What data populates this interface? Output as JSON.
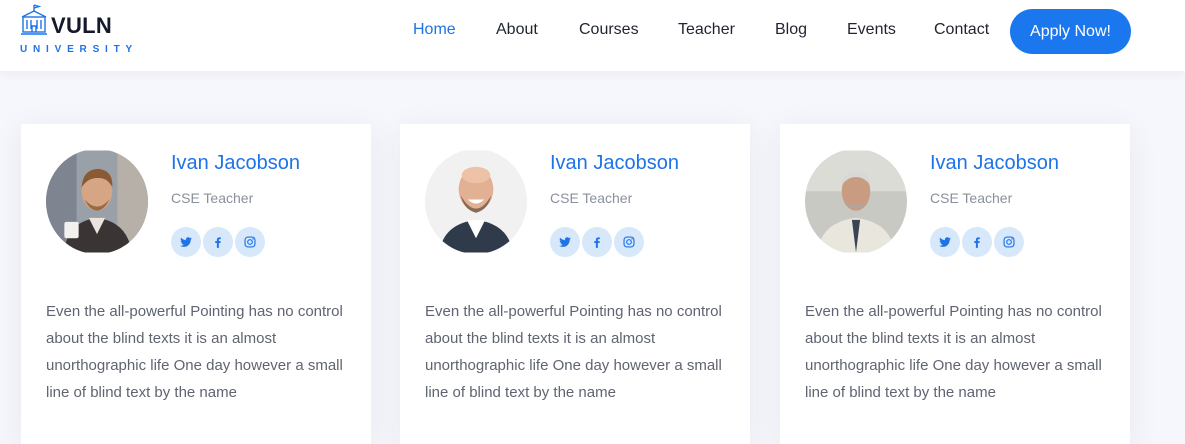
{
  "brand": {
    "name": "VULN",
    "tagline": "UNIVERSITY",
    "accent_color": "#1e73e8"
  },
  "nav": {
    "items": [
      {
        "label": "Home",
        "active": true
      },
      {
        "label": "About",
        "active": false
      },
      {
        "label": "Courses",
        "active": false
      },
      {
        "label": "Teacher",
        "active": false
      },
      {
        "label": "Blog",
        "active": false
      },
      {
        "label": "Events",
        "active": false
      },
      {
        "label": "Contact",
        "active": false
      }
    ],
    "cta_label": "Apply Now!"
  },
  "teachers": [
    {
      "name": "Ivan Jacobson",
      "role": "CSE Teacher",
      "photo": "portrait-young-man-coffee",
      "socials": [
        "twitter-icon",
        "facebook-icon",
        "instagram-icon"
      ],
      "bio": "Even the all-powerful Pointing has no control about the blind texts it is an almost unorthographic life One day however a small line of blind text by the name"
    },
    {
      "name": "Ivan Jacobson",
      "role": "CSE Teacher",
      "photo": "portrait-bald-man-laughing",
      "socials": [
        "twitter-icon",
        "facebook-icon",
        "instagram-icon"
      ],
      "bio": "Even the all-powerful Pointing has no control about the blind texts it is an almost unorthographic life One day however a small line of blind text by the name"
    },
    {
      "name": "Ivan Jacobson",
      "role": "CSE Teacher",
      "photo": "portrait-older-man-tie",
      "socials": [
        "twitter-icon",
        "facebook-icon",
        "instagram-icon"
      ],
      "bio": "Even the all-powerful Pointing has no control about the blind texts it is an almost unorthographic life One day however a small line of blind text by the name"
    }
  ]
}
